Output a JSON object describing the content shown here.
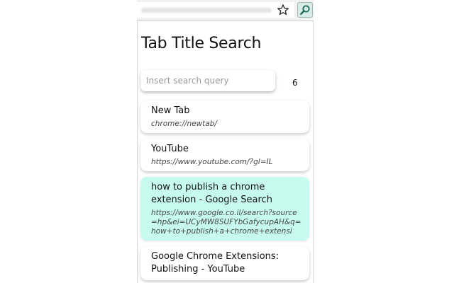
{
  "browser": {
    "omnibox_value": ""
  },
  "popup": {
    "title": "Tab Title Search",
    "search": {
      "placeholder": "Insert search query",
      "value": ""
    },
    "result_count": "6",
    "tabs": [
      {
        "title": "New Tab",
        "url": "chrome://newtab/",
        "active": false
      },
      {
        "title": "YouTube",
        "url": "https://www.youtube.com/?gl=IL",
        "active": false
      },
      {
        "title": "how to publish a chrome extension - Google Search",
        "url": "https://www.google.co.il/search?source=hp&ei=UCyMW8SUFYbGafycupAH&q=how+to+publish+a+chrome+extensio...",
        "active": true
      },
      {
        "title": "Google Chrome Extensions: Publishing - YouTube",
        "url": "",
        "active": false
      }
    ]
  },
  "colors": {
    "active_tab_bg": "#c8fbf0",
    "extension_button_bg": "#d9ebe6",
    "extension_icon": "#1f6b5c"
  },
  "icons": [
    "star-icon",
    "magnifier-icon"
  ]
}
